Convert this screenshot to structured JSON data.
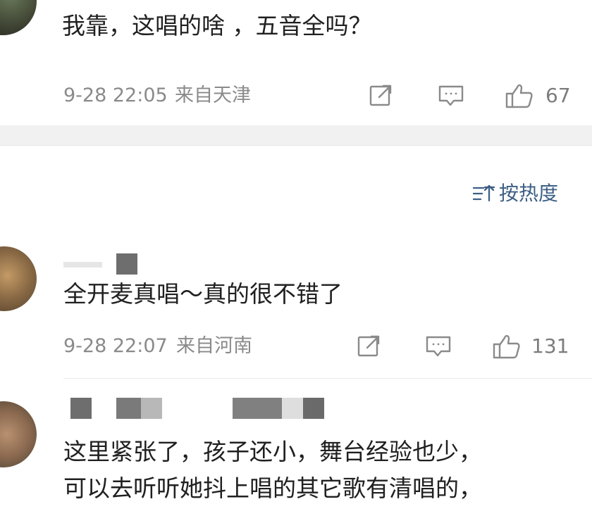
{
  "comments": [
    {
      "text": "我靠，这唱的啥 ，五音全吗？",
      "time": "9-28 22:05",
      "from": "来自天津",
      "likes": "67"
    },
    {
      "text": "全开麦真唱～真的很不错了",
      "time": "9-28 22:07",
      "from": "来自河南",
      "likes": "131"
    },
    {
      "text_line1": "这里紧张了，孩子还小，舞台经验也少，",
      "text_line2": "可以去听听她抖上唱的其它歌有清唱的，"
    }
  ],
  "sort": {
    "label": "按热度"
  },
  "icons": {
    "share": "share-icon",
    "comment": "comment-icon",
    "like": "thumbs-up-icon",
    "sort": "sort-icon"
  },
  "colors": {
    "text": "#202020",
    "meta": "#8a8a8a",
    "sort_accent": "#3d5f86",
    "icon_gray": "#8a8a8a",
    "band": "#f1f1f1"
  }
}
